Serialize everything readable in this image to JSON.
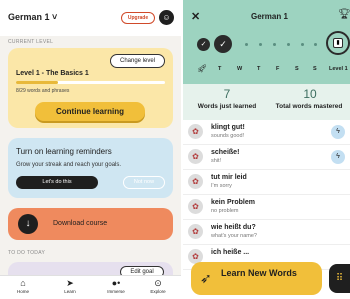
{
  "left": {
    "course_title": "German 1 ˅",
    "upgrade_label": "Upgrade",
    "profile_icon": "user-icon",
    "current_level_heading": "CURRENT LEVEL",
    "change_level_label": "Change level",
    "level_title": "Level 1 - The Basics 1",
    "progress_fraction": 0.28,
    "words_progress": "8/29 words and phrases",
    "continue_label": "Continue learning",
    "reminder_title": "Turn on learning reminders",
    "reminder_subtitle": "Grow your streak and reach your goals.",
    "lets_do_this_label": "Let's do this",
    "not_now_label": "Not now",
    "download_label": "Download course",
    "todo_heading": "TO DO TODAY",
    "edit_goal_label": "Edit goal",
    "nav": [
      {
        "label": "Home",
        "icon": "home-icon"
      },
      {
        "label": "Learn",
        "icon": "learn-icon"
      },
      {
        "label": "Immerse",
        "icon": "immerse-icon"
      },
      {
        "label": "Explore",
        "icon": "explore-icon"
      }
    ]
  },
  "right": {
    "title": "German 1",
    "close_icon": "close-icon",
    "trophy_icon": "trophy-icon",
    "days": [
      "T",
      "W",
      "T",
      "F",
      "S",
      "S"
    ],
    "level_label": "Level 1",
    "words_learned_count": "7",
    "words_learned_label": "Words just learned",
    "words_mastered_count": "10",
    "words_mastered_label": "Total words mastered",
    "words": [
      {
        "de": "klingt gut!",
        "en": "sounds good!"
      },
      {
        "de": "scheiße!",
        "en": "shit!"
      },
      {
        "de": "tut mir leid",
        "en": "I'm sorry"
      },
      {
        "de": "kein Problem",
        "en": "no problem"
      },
      {
        "de": "wie heißt du?",
        "en": "what's your name?"
      },
      {
        "de": "ich heiße ...",
        "en": ""
      }
    ],
    "learn_new_label": "Learn New Words",
    "menu_icon": "grid-menu-icon"
  },
  "colors": {
    "accent_yellow": "#f1bf3a",
    "mint": "#9dd3c0",
    "reminder_blue": "#cfe6f2",
    "download_orange": "#ef8a5e",
    "upgrade_red": "#d04a2a"
  }
}
